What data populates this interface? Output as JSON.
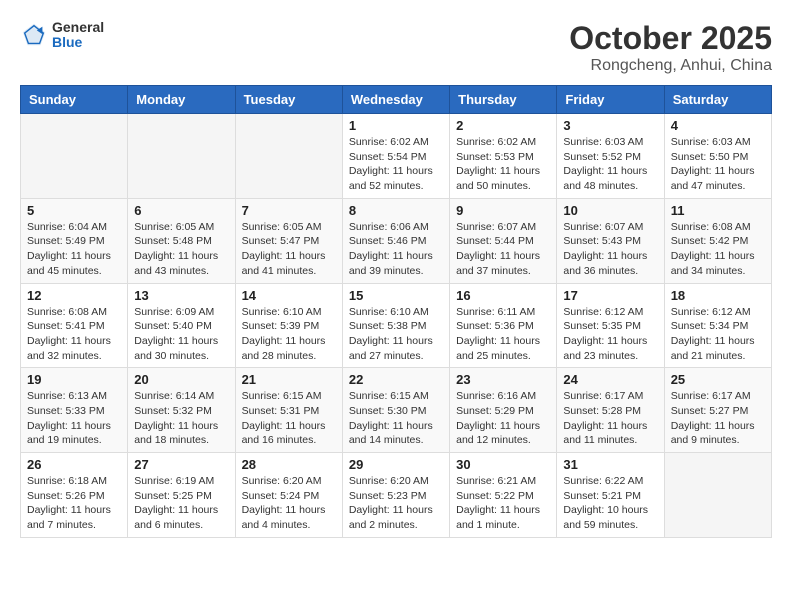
{
  "logo": {
    "general": "General",
    "blue": "Blue"
  },
  "header": {
    "month": "October 2025",
    "location": "Rongcheng, Anhui, China"
  },
  "weekdays": [
    "Sunday",
    "Monday",
    "Tuesday",
    "Wednesday",
    "Thursday",
    "Friday",
    "Saturday"
  ],
  "weeks": [
    [
      {
        "day": "",
        "info": ""
      },
      {
        "day": "",
        "info": ""
      },
      {
        "day": "",
        "info": ""
      },
      {
        "day": "1",
        "info": "Sunrise: 6:02 AM\nSunset: 5:54 PM\nDaylight: 11 hours\nand 52 minutes."
      },
      {
        "day": "2",
        "info": "Sunrise: 6:02 AM\nSunset: 5:53 PM\nDaylight: 11 hours\nand 50 minutes."
      },
      {
        "day": "3",
        "info": "Sunrise: 6:03 AM\nSunset: 5:52 PM\nDaylight: 11 hours\nand 48 minutes."
      },
      {
        "day": "4",
        "info": "Sunrise: 6:03 AM\nSunset: 5:50 PM\nDaylight: 11 hours\nand 47 minutes."
      }
    ],
    [
      {
        "day": "5",
        "info": "Sunrise: 6:04 AM\nSunset: 5:49 PM\nDaylight: 11 hours\nand 45 minutes."
      },
      {
        "day": "6",
        "info": "Sunrise: 6:05 AM\nSunset: 5:48 PM\nDaylight: 11 hours\nand 43 minutes."
      },
      {
        "day": "7",
        "info": "Sunrise: 6:05 AM\nSunset: 5:47 PM\nDaylight: 11 hours\nand 41 minutes."
      },
      {
        "day": "8",
        "info": "Sunrise: 6:06 AM\nSunset: 5:46 PM\nDaylight: 11 hours\nand 39 minutes."
      },
      {
        "day": "9",
        "info": "Sunrise: 6:07 AM\nSunset: 5:44 PM\nDaylight: 11 hours\nand 37 minutes."
      },
      {
        "day": "10",
        "info": "Sunrise: 6:07 AM\nSunset: 5:43 PM\nDaylight: 11 hours\nand 36 minutes."
      },
      {
        "day": "11",
        "info": "Sunrise: 6:08 AM\nSunset: 5:42 PM\nDaylight: 11 hours\nand 34 minutes."
      }
    ],
    [
      {
        "day": "12",
        "info": "Sunrise: 6:08 AM\nSunset: 5:41 PM\nDaylight: 11 hours\nand 32 minutes."
      },
      {
        "day": "13",
        "info": "Sunrise: 6:09 AM\nSunset: 5:40 PM\nDaylight: 11 hours\nand 30 minutes."
      },
      {
        "day": "14",
        "info": "Sunrise: 6:10 AM\nSunset: 5:39 PM\nDaylight: 11 hours\nand 28 minutes."
      },
      {
        "day": "15",
        "info": "Sunrise: 6:10 AM\nSunset: 5:38 PM\nDaylight: 11 hours\nand 27 minutes."
      },
      {
        "day": "16",
        "info": "Sunrise: 6:11 AM\nSunset: 5:36 PM\nDaylight: 11 hours\nand 25 minutes."
      },
      {
        "day": "17",
        "info": "Sunrise: 6:12 AM\nSunset: 5:35 PM\nDaylight: 11 hours\nand 23 minutes."
      },
      {
        "day": "18",
        "info": "Sunrise: 6:12 AM\nSunset: 5:34 PM\nDaylight: 11 hours\nand 21 minutes."
      }
    ],
    [
      {
        "day": "19",
        "info": "Sunrise: 6:13 AM\nSunset: 5:33 PM\nDaylight: 11 hours\nand 19 minutes."
      },
      {
        "day": "20",
        "info": "Sunrise: 6:14 AM\nSunset: 5:32 PM\nDaylight: 11 hours\nand 18 minutes."
      },
      {
        "day": "21",
        "info": "Sunrise: 6:15 AM\nSunset: 5:31 PM\nDaylight: 11 hours\nand 16 minutes."
      },
      {
        "day": "22",
        "info": "Sunrise: 6:15 AM\nSunset: 5:30 PM\nDaylight: 11 hours\nand 14 minutes."
      },
      {
        "day": "23",
        "info": "Sunrise: 6:16 AM\nSunset: 5:29 PM\nDaylight: 11 hours\nand 12 minutes."
      },
      {
        "day": "24",
        "info": "Sunrise: 6:17 AM\nSunset: 5:28 PM\nDaylight: 11 hours\nand 11 minutes."
      },
      {
        "day": "25",
        "info": "Sunrise: 6:17 AM\nSunset: 5:27 PM\nDaylight: 11 hours\nand 9 minutes."
      }
    ],
    [
      {
        "day": "26",
        "info": "Sunrise: 6:18 AM\nSunset: 5:26 PM\nDaylight: 11 hours\nand 7 minutes."
      },
      {
        "day": "27",
        "info": "Sunrise: 6:19 AM\nSunset: 5:25 PM\nDaylight: 11 hours\nand 6 minutes."
      },
      {
        "day": "28",
        "info": "Sunrise: 6:20 AM\nSunset: 5:24 PM\nDaylight: 11 hours\nand 4 minutes."
      },
      {
        "day": "29",
        "info": "Sunrise: 6:20 AM\nSunset: 5:23 PM\nDaylight: 11 hours\nand 2 minutes."
      },
      {
        "day": "30",
        "info": "Sunrise: 6:21 AM\nSunset: 5:22 PM\nDaylight: 11 hours\nand 1 minute."
      },
      {
        "day": "31",
        "info": "Sunrise: 6:22 AM\nSunset: 5:21 PM\nDaylight: 10 hours\nand 59 minutes."
      },
      {
        "day": "",
        "info": ""
      }
    ]
  ]
}
